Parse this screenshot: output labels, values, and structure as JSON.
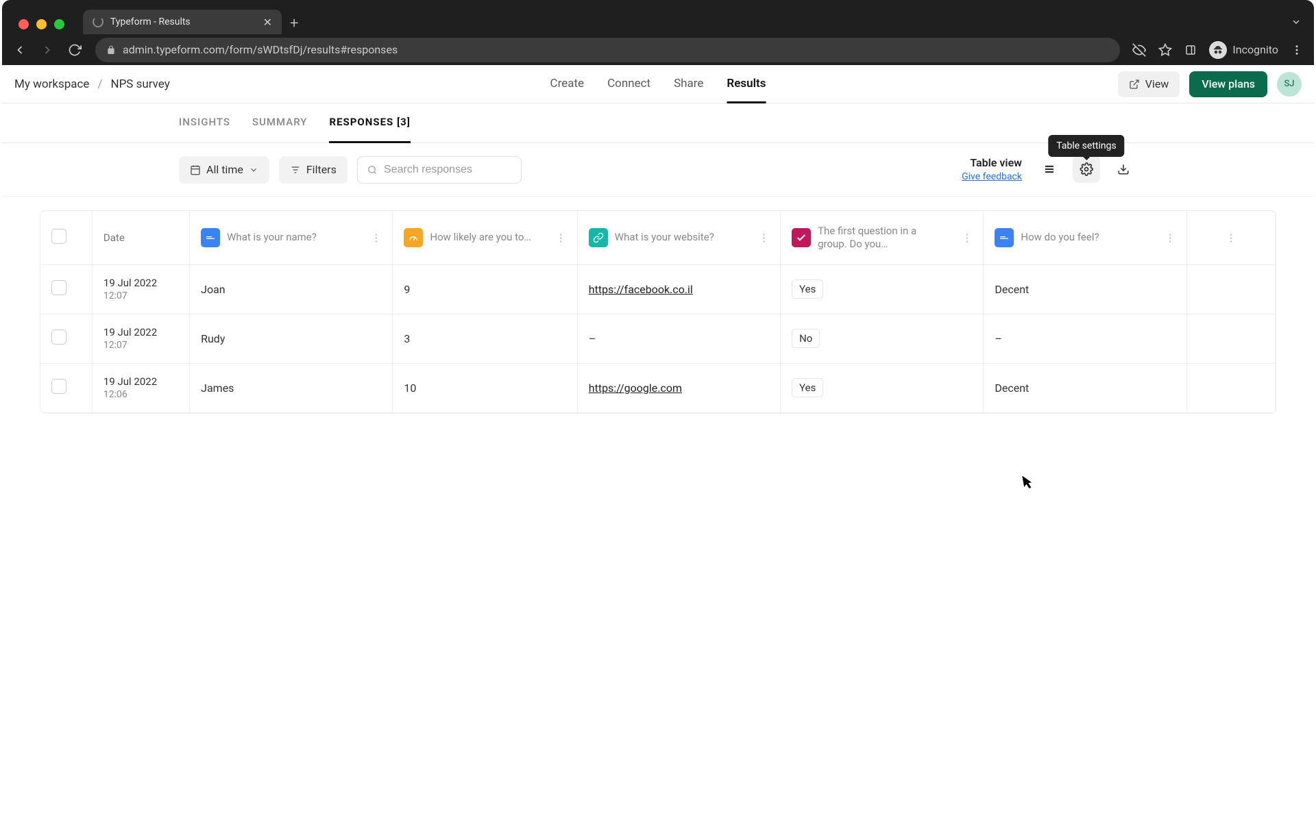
{
  "browser": {
    "tab_title": "Typeform - Results",
    "url": "admin.typeform.com/form/sWDtsfDj/results#responses",
    "incognito_label": "Incognito"
  },
  "header": {
    "breadcrumb_workspace": "My workspace",
    "breadcrumb_form": "NPS survey",
    "tabs": {
      "create": "Create",
      "connect": "Connect",
      "share": "Share",
      "results": "Results"
    },
    "view_btn": "View",
    "plans_btn": "View plans",
    "avatar": "SJ"
  },
  "subtabs": {
    "insights": "INSIGHTS",
    "summary": "SUMMARY",
    "responses": "RESPONSES [3]"
  },
  "toolbar": {
    "date_filter": "All time",
    "filters_btn": "Filters",
    "search_placeholder": "Search responses",
    "table_view_label": "Table view",
    "feedback_link": "Give feedback",
    "tooltip": "Table settings"
  },
  "table": {
    "headers": {
      "date": "Date",
      "q1": "What is your name?",
      "q2": "How likely are you to…",
      "q3": "What is your website?",
      "q4": "The first question in a group. Do you…",
      "q5": "How do you feel?"
    },
    "rows": [
      {
        "date": "19 Jul 2022",
        "time": "12:07",
        "name": "Joan",
        "likely": "9",
        "website": "https://facebook.co.il",
        "group": "Yes",
        "feel": "Decent"
      },
      {
        "date": "19 Jul 2022",
        "time": "12:07",
        "name": "Rudy",
        "likely": "3",
        "website": "–",
        "group": "No",
        "feel": "–"
      },
      {
        "date": "19 Jul 2022",
        "time": "12:06",
        "name": "James",
        "likely": "10",
        "website": "https://google.com",
        "group": "Yes",
        "feel": "Decent"
      }
    ]
  }
}
